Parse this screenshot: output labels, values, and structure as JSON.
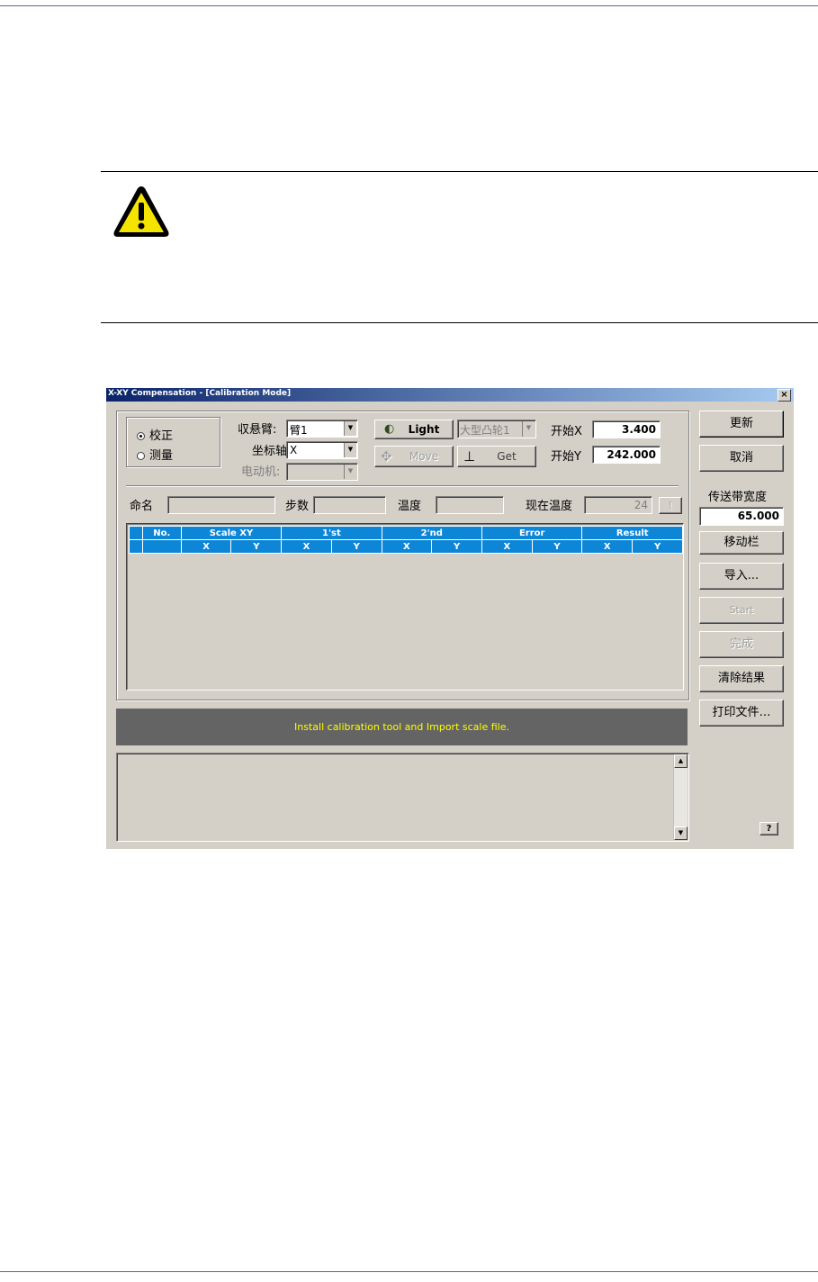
{
  "window": {
    "title": "X-XY Compensation - [Calibration Mode]",
    "close_label": "×"
  },
  "mode": {
    "calibrate_label": "校正",
    "measure_label": "测量",
    "selected": "calibrate_label"
  },
  "controls": {
    "arm_label": "収悬臂:",
    "arm_value": "臂1",
    "axis_label": "坐标轴",
    "axis_value": "X",
    "motor_label": "电动机:",
    "motor_value": "",
    "light_label": "Light",
    "cam_value": "大型凸轮1",
    "move_label": "Move",
    "get_label": "Get",
    "start_x_label": "开始X",
    "start_x_value": "3.400",
    "start_y_label": "开始Y",
    "start_y_value": "242.000"
  },
  "info": {
    "name_label": "命名",
    "name_value": "",
    "steps_label": "步数",
    "steps_value": "",
    "temp_label": "温度",
    "temp_value": "",
    "current_temp_label": "现在温度",
    "current_temp_value": "24",
    "alert_label": "!"
  },
  "grid": {
    "columns": [
      "No.",
      "Scale XY",
      "1'st",
      "2'nd",
      "Error",
      "Result"
    ],
    "subcolumns": [
      "X",
      "Y"
    ]
  },
  "status_message": "Install calibration tool and Import scale file.",
  "sidebar": {
    "update_label": "更新",
    "cancel_label": "取消",
    "belt_width_label": "传送带宽度",
    "belt_width_value": "65.000",
    "move_bar_label": "移动栏",
    "import_label": "导入...",
    "start_label": "Start",
    "finish_label": "完成",
    "clear_label": "清除结果",
    "print_label": "打印文件…",
    "help_label": "?"
  }
}
